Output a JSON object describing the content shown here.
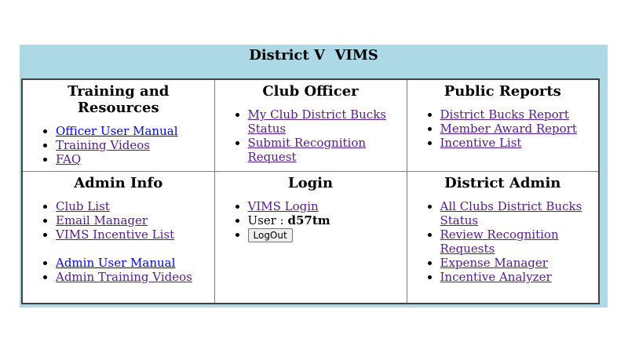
{
  "page": {
    "title": "District V  VIMS"
  },
  "colors": {
    "frame_background": "#add8e6",
    "link_unvisited": "#0000ee",
    "link_visited": "#551a8b"
  },
  "sections": {
    "training": {
      "title": "Training and Resources",
      "links": [
        "Officer User Manual",
        "Training Videos",
        "FAQ"
      ]
    },
    "club_officer": {
      "title": "Club Officer",
      "links": [
        "My Club District Bucks Status",
        "Submit Recognition Request"
      ]
    },
    "public_reports": {
      "title": "Public Reports",
      "links": [
        "District Bucks Report",
        "Member Award Report",
        "Incentive List"
      ]
    },
    "admin_info": {
      "title": "Admin Info",
      "links": [
        "Club List",
        "Email Manager",
        "VIMS Incentive List"
      ],
      "links2": [
        "Admin User Manual",
        "Admin Training Videos"
      ]
    },
    "login": {
      "title": "Login",
      "vims_login": "VIMS Login",
      "user_label": "User : ",
      "user_value": "d57tm",
      "logout_label": "LogOut"
    },
    "district_admin": {
      "title": "District Admin",
      "links": [
        "All Clubs District Bucks Status",
        "Review Recognition Requests",
        "Expense Manager",
        "Incentive Analyzer"
      ]
    }
  }
}
